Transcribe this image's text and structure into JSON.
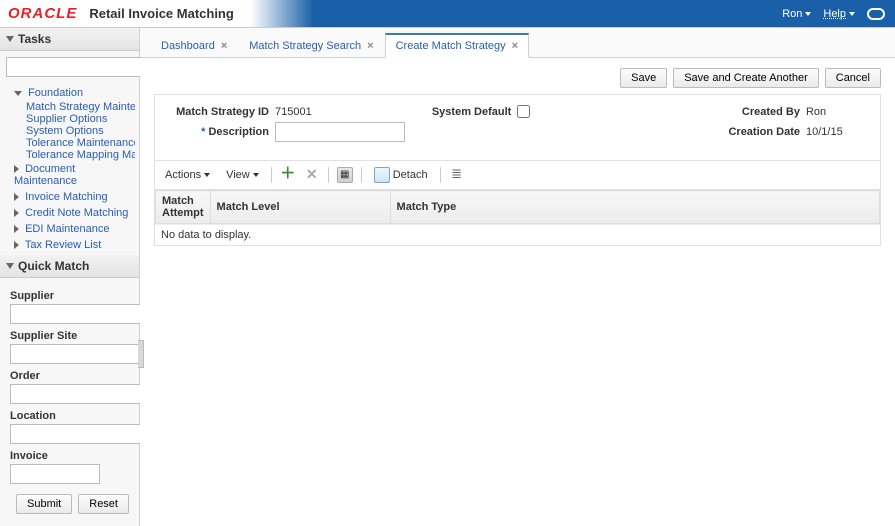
{
  "header": {
    "logo_text": "ORACLE",
    "app_title": "Retail Invoice Matching",
    "user_label": "Ron",
    "help_label": "Help"
  },
  "sidebar": {
    "tasks_title": "Tasks",
    "search_placeholder": "",
    "tree": {
      "foundation": "Foundation",
      "children": [
        "Match Strategy Maintenance",
        "Supplier Options",
        "System Options",
        "Tolerance Maintenance",
        "Tolerance Mapping Maintena"
      ],
      "others": [
        "Document Maintenance",
        "Invoice Matching",
        "Credit Note Matching",
        "EDI Maintenance",
        "Tax Review List"
      ]
    },
    "quick_match": {
      "title": "Quick Match",
      "supplier": "Supplier",
      "supplier_site": "Supplier Site",
      "order": "Order",
      "location": "Location",
      "invoice": "Invoice",
      "submit": "Submit",
      "reset": "Reset"
    }
  },
  "tabs": [
    {
      "label": "Dashboard",
      "active": false
    },
    {
      "label": "Match Strategy Search",
      "active": false
    },
    {
      "label": "Create Match Strategy",
      "active": true
    }
  ],
  "top_actions": {
    "save": "Save",
    "save_another": "Save and Create Another",
    "cancel": "Cancel"
  },
  "form": {
    "id_label": "Match Strategy ID",
    "id_value": "715001",
    "desc_label": "Description",
    "desc_value": "",
    "sysdef_label": "System Default",
    "sysdef_checked": false,
    "created_by_label": "Created By",
    "created_by_value": "Ron",
    "creation_date_label": "Creation Date",
    "creation_date_value": "10/1/15"
  },
  "toolbar": {
    "actions": "Actions",
    "view": "View",
    "detach": "Detach"
  },
  "grid": {
    "col_attempt": "Match Attempt",
    "col_level": "Match Level",
    "col_type": "Match Type",
    "empty_msg": "No data to display."
  }
}
